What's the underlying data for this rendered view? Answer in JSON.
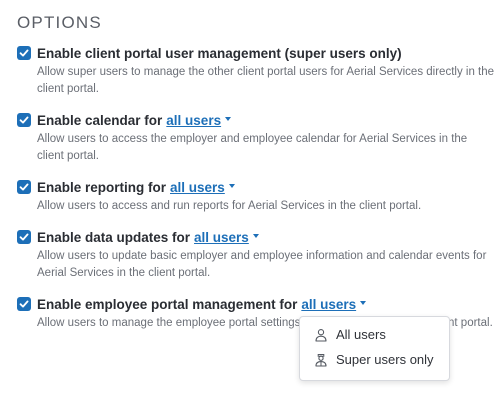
{
  "section_title": "OPTIONS",
  "options": [
    {
      "label": "Enable client portal user management (super users only)",
      "scope": "",
      "description": "Allow super users to manage the other client portal users for Aerial Services directly in the client portal.",
      "checked": true
    },
    {
      "label": "Enable calendar for",
      "scope": "all users",
      "description": "Allow users to access the employer and employee calendar for Aerial Services in the client portal.",
      "checked": true
    },
    {
      "label": "Enable reporting for",
      "scope": "all users",
      "description": "Allow users to access and run reports for Aerial Services in the client portal.",
      "checked": true
    },
    {
      "label": "Enable data updates for",
      "scope": "all users",
      "description": "Allow users to update basic employer and employee information and calendar events for Aerial Services in the client portal.",
      "checked": true
    },
    {
      "label": "Enable employee portal management for",
      "scope": "all users",
      "description": "Allow users to manage the employee portal settings for Aerial Services in the client portal.",
      "checked": true
    }
  ],
  "dropdown": {
    "items": [
      {
        "label": "All users",
        "icon": "user-icon"
      },
      {
        "label": "Super users only",
        "icon": "super-user-icon"
      }
    ]
  },
  "colors": {
    "accent": "#1d6fb8",
    "text": "#2a2d33",
    "muted": "#6b6f77"
  }
}
